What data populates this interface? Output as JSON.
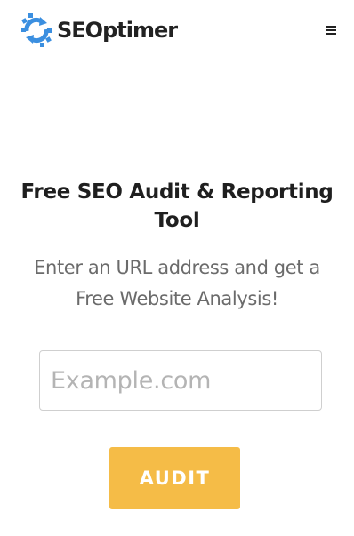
{
  "header": {
    "logo_text": "SEOptimer",
    "logo_icon": "gear-sync-icon",
    "menu_icon": "hamburger-menu-icon"
  },
  "hero": {
    "title": "Free SEO Audit & Reporting Tool",
    "subtitle": "Enter an URL address and get a Free Website Analysis!"
  },
  "form": {
    "url_placeholder": "Example.com",
    "url_value": "",
    "submit_label": "AUDIT"
  },
  "colors": {
    "brand_blue": "#3b8fe0",
    "accent_yellow": "#f5bc47",
    "title_text": "#1f1f1f",
    "subtitle_text": "#6b6b6b"
  }
}
